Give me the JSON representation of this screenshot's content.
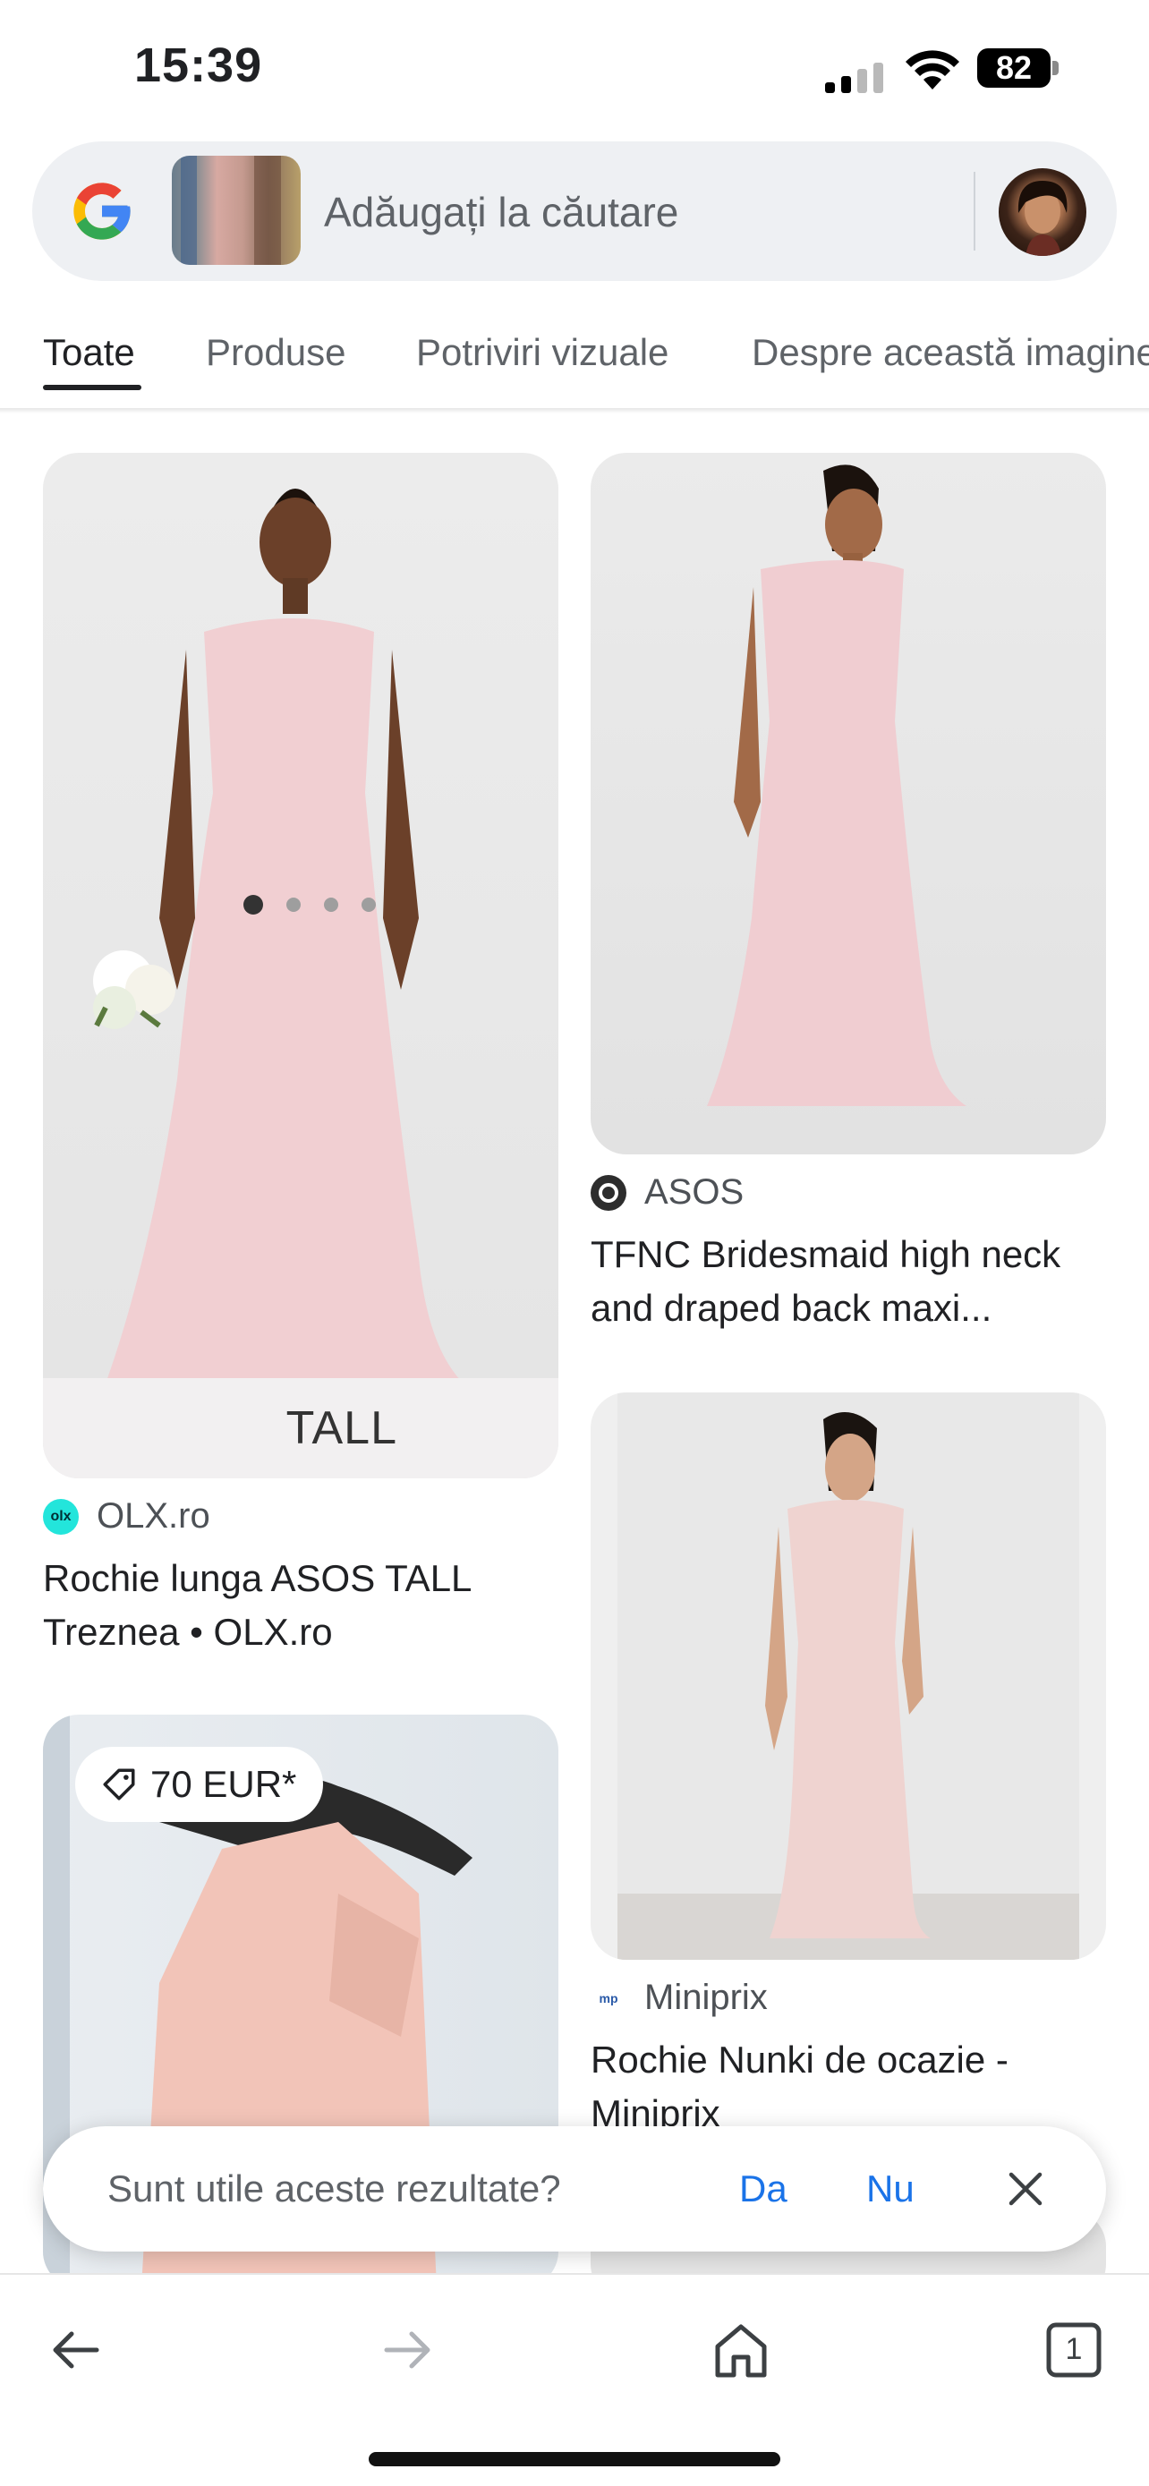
{
  "status_bar": {
    "time": "15:39",
    "battery": "82"
  },
  "search": {
    "placeholder": "Adăugați la căutare"
  },
  "tabs": [
    {
      "label": "Toate",
      "active": true
    },
    {
      "label": "Produse"
    },
    {
      "label": "Potriviri vizuale"
    },
    {
      "label": "Despre această imagine"
    }
  ],
  "results": [
    {
      "source": "OLX.ro",
      "title": "Rochie lunga ASOS TALL Treznea • OLX.ro",
      "image_caption": "TALL",
      "carousel_total": 4,
      "carousel_active": 1
    },
    {
      "source": "ASOS",
      "title": "TFNC Bridesmaid high neck and draped back maxi..."
    },
    {
      "source": "Miniprix",
      "title": "Rochie Nunki de ocazie - Miniprix"
    },
    {
      "price": "70 EUR*"
    }
  ],
  "feedback": {
    "question": "Sunt utile aceste rezultate?",
    "yes": "Da",
    "no": "Nu"
  },
  "bottom_nav": {
    "tab_count": "1"
  },
  "colors": {
    "accent": "#1a73e8",
    "google_blue": "#4285F4",
    "google_red": "#EA4335",
    "google_yellow": "#FBBC05",
    "google_green": "#34A853"
  }
}
